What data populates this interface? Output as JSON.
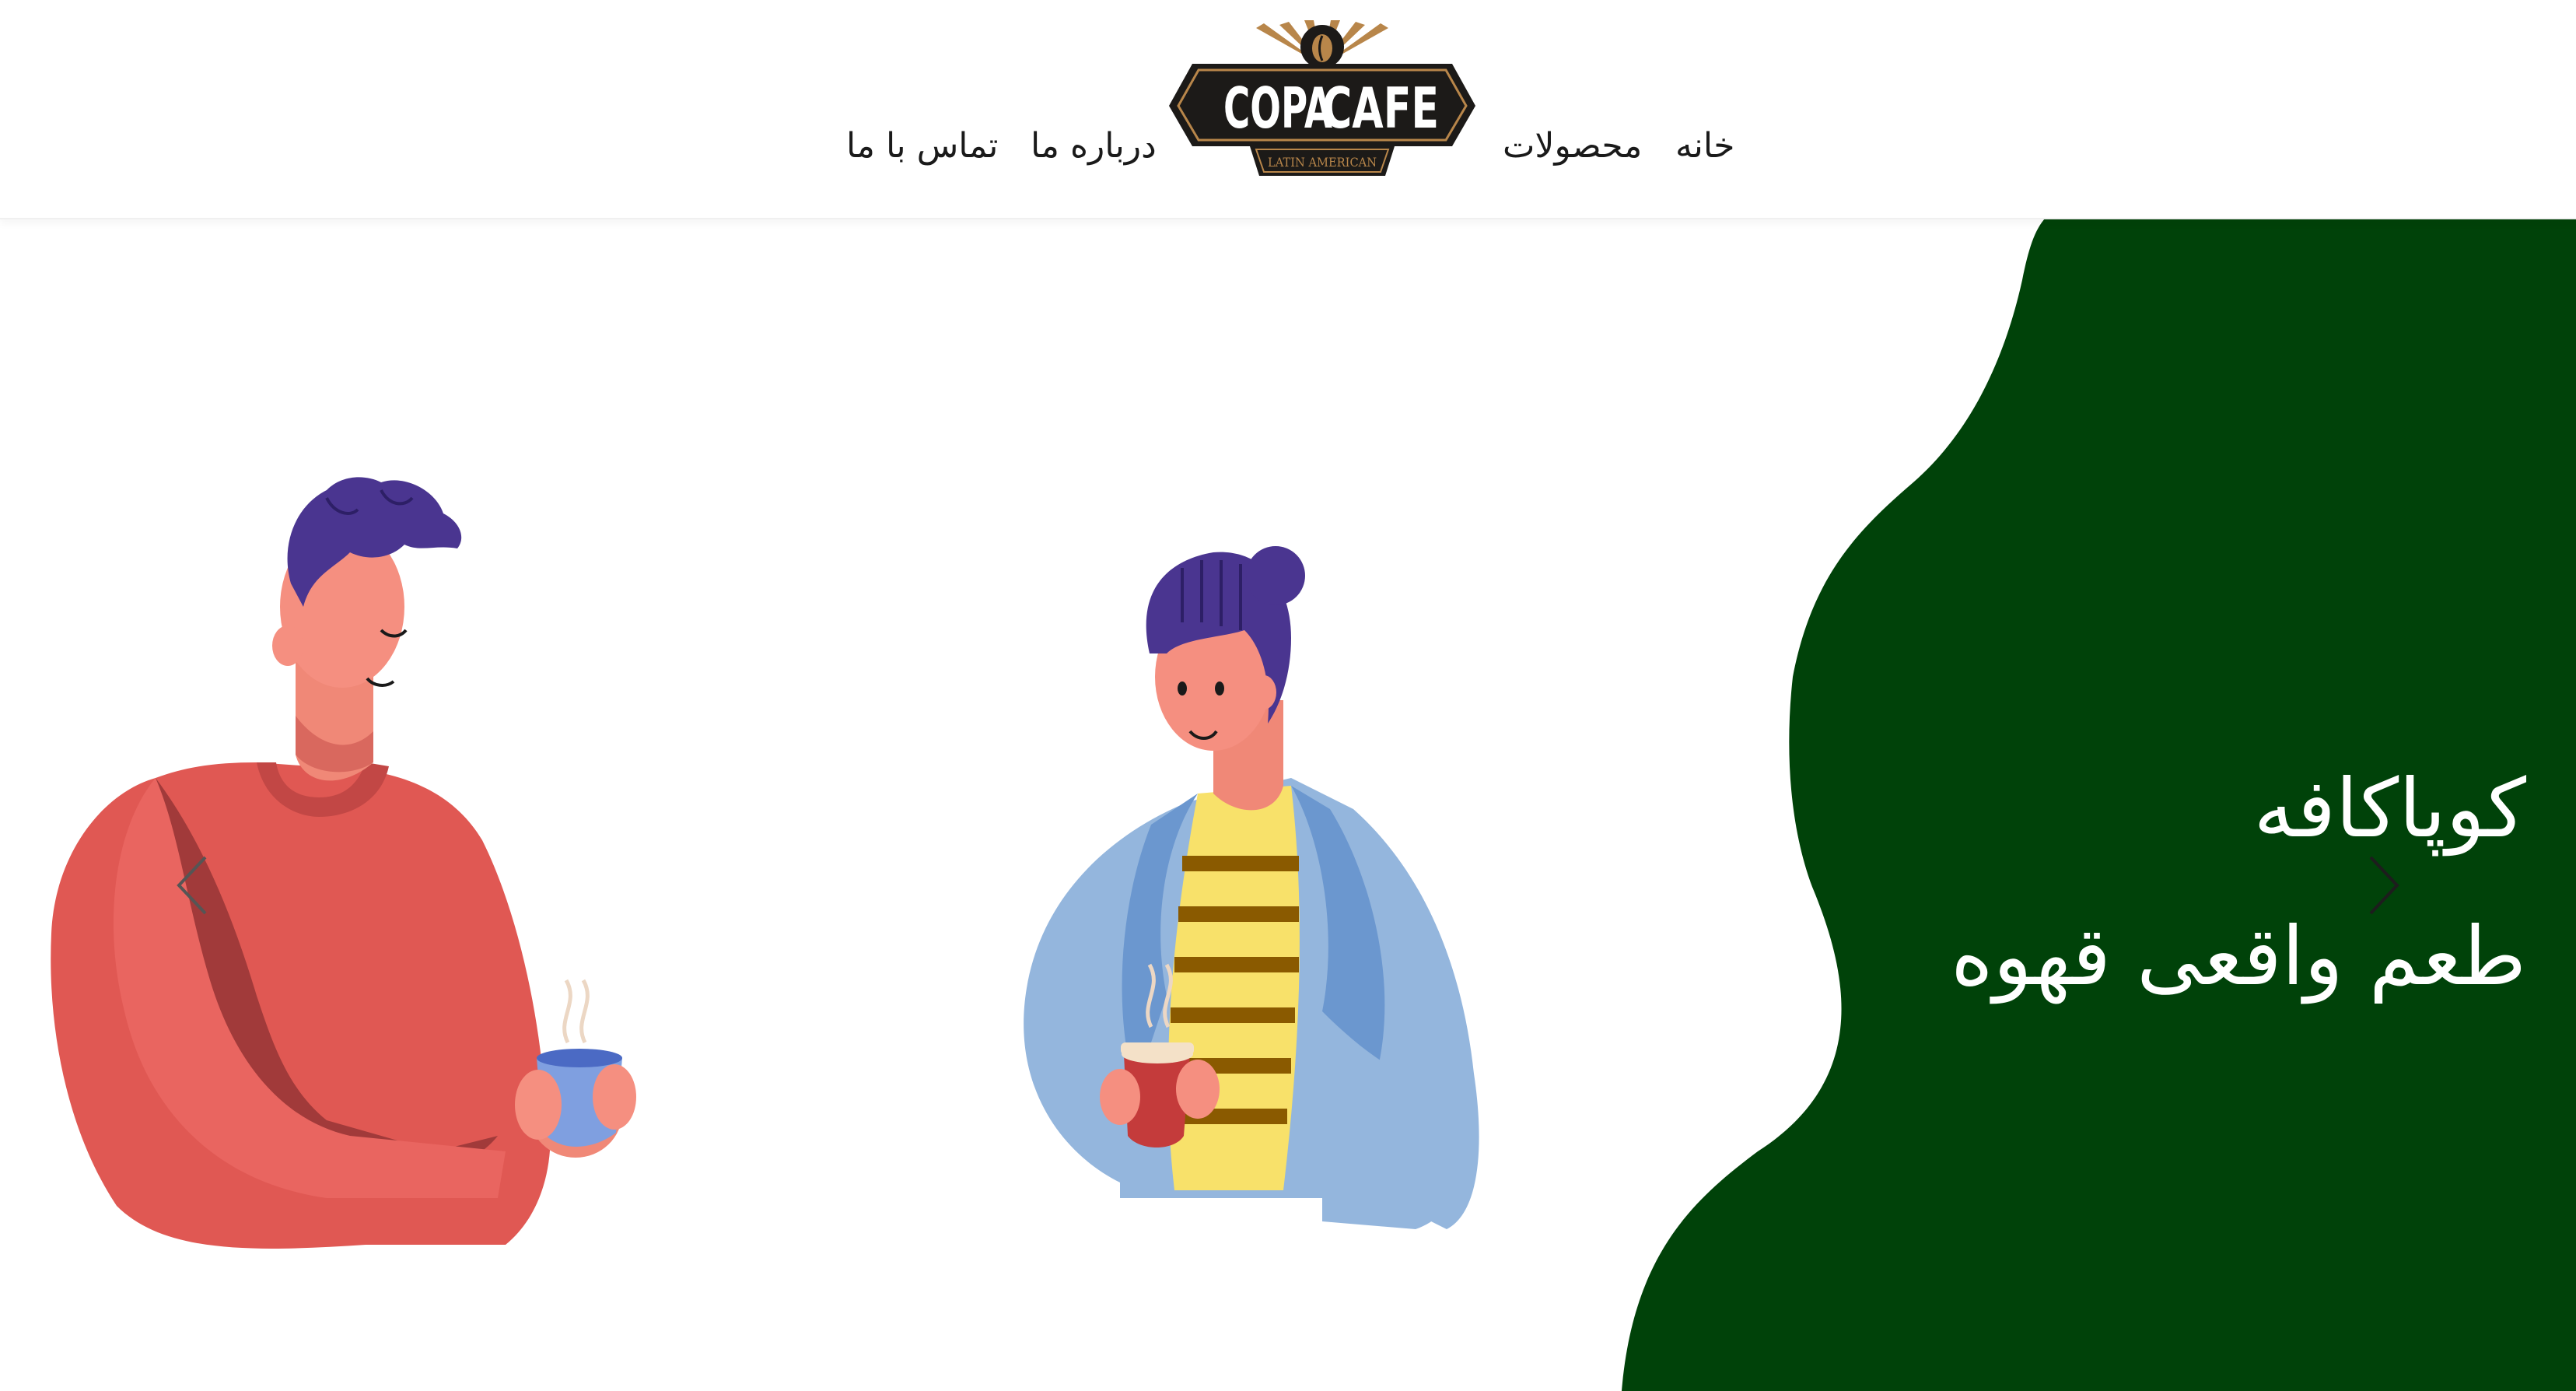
{
  "nav": {
    "items": [
      {
        "id": "home",
        "label": "خانه"
      },
      {
        "id": "products",
        "label": "محصولات"
      },
      {
        "id": "about",
        "label": "درباره ما"
      },
      {
        "id": "contact",
        "label": "تماس با ما"
      }
    ]
  },
  "logo": {
    "brand_left": "COPA",
    "brand_right": "CAFE",
    "tagline": "LATIN AMERICAN"
  },
  "hero": {
    "title_line1": "کوپاکافه",
    "title_line2": "طعم واقعی قهوه"
  },
  "colors": {
    "hero_green": "#004209",
    "logo_dark": "#1c1a18",
    "logo_gold": "#b8864a",
    "text": "#1a1a1a",
    "man_sweater": "#e05853",
    "woman_jacket": "#94b6dd",
    "hair": "#4a3590"
  },
  "icons": [
    "chevron-left-icon",
    "chevron-right-icon",
    "coffee-bean-icon",
    "steam-icon"
  ]
}
